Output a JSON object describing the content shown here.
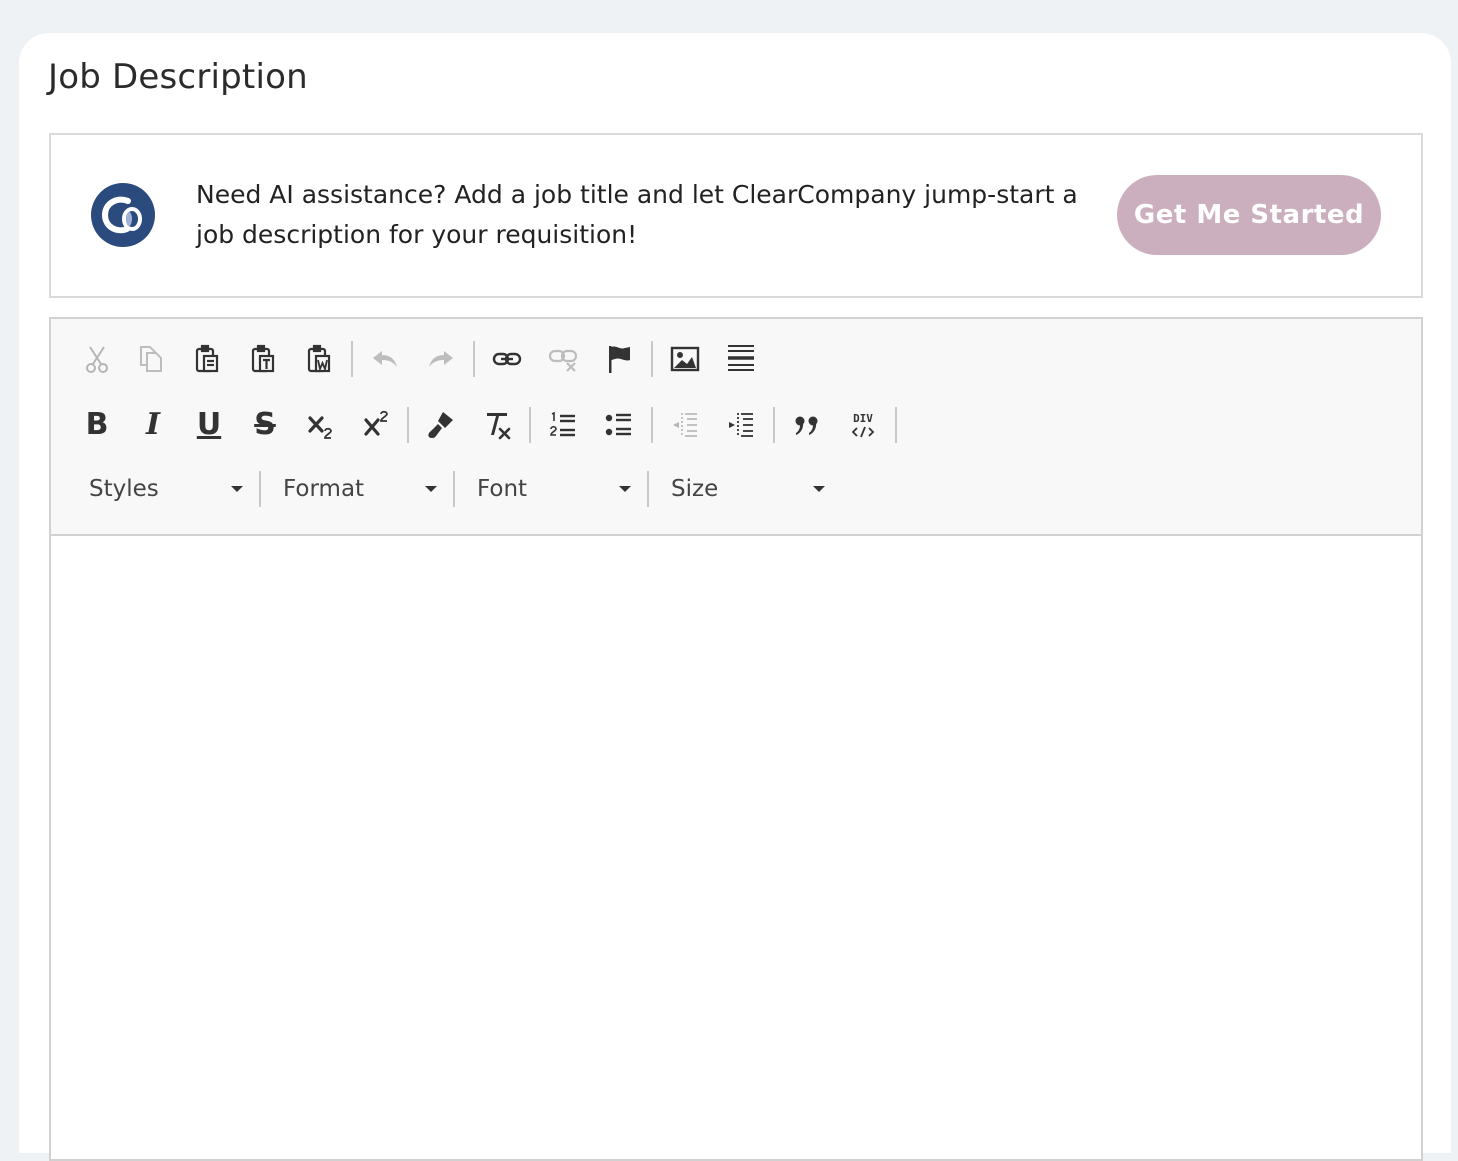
{
  "section": {
    "title": "Job Description"
  },
  "ai_banner": {
    "message": "Need AI assistance? Add a job title and let ClearCompany jump-start a job description for your requisition!",
    "button_label": "Get Me Started",
    "logo_letters": "Co",
    "logo_color": "#2b4a7e",
    "button_color": "#ccafbe"
  },
  "toolbar": {
    "row1": [
      "scissors-icon",
      "copy-icon",
      "paste-icon",
      "paste-text-icon",
      "paste-word-icon",
      "undo-icon",
      "redo-icon",
      "link-icon",
      "unlink-icon",
      "anchor-icon",
      "image-icon",
      "horizontal-line-icon"
    ],
    "row2": [
      "bold-icon",
      "italic-icon",
      "underline-icon",
      "strikethrough-icon",
      "subscript-icon",
      "superscript-icon",
      "copy-format-icon",
      "remove-format-icon",
      "numbered-list-icon",
      "bulleted-list-icon",
      "decrease-indent-icon",
      "increase-indent-icon",
      "blockquote-icon",
      "div-container-icon"
    ],
    "bold_glyph": "B",
    "italic_glyph": "I",
    "underline_glyph": "U",
    "strike_glyph": "S",
    "div_glyph": "DIV",
    "styles_label": "Styles",
    "format_label": "Format",
    "font_label": "Font",
    "size_label": "Size"
  },
  "editor": {
    "content": ""
  }
}
